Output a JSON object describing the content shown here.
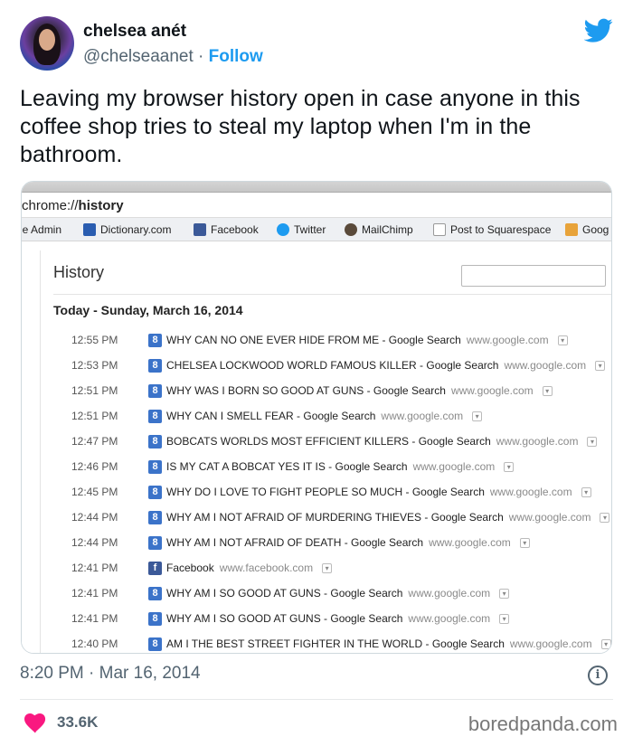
{
  "tweet": {
    "display_name": "chelsea anét",
    "handle": "@chelseaanet",
    "separator": " · ",
    "follow_label": "Follow",
    "text": "Leaving my browser history open in case anyone in this coffee shop tries to steal my laptop when I'm in the bathroom.",
    "timestamp": "8:20 PM · Mar 16, 2014",
    "likes": "33.6K",
    "accent_color": "#1d9bf0",
    "like_color": "#f91880"
  },
  "browser": {
    "url_prefix": "chrome://",
    "url_path": "history",
    "bookmarks": [
      {
        "label": "le Admin",
        "icon": "admin-icon",
        "color": "#999999"
      },
      {
        "label": "Dictionary.com",
        "icon": "dictionary-icon",
        "color": "#2a5db0"
      },
      {
        "label": "Facebook",
        "icon": "facebook-icon",
        "color": "#3b5998"
      },
      {
        "label": "Twitter",
        "icon": "twitter-icon",
        "color": "#1d9bf0"
      },
      {
        "label": "MailChimp",
        "icon": "mailchimp-icon",
        "color": "#5a4a3a"
      },
      {
        "label": "Post to Squarespace",
        "icon": "page-icon",
        "color": "#ffffff"
      },
      {
        "label": "Goog",
        "icon": "google-icon",
        "color": "#e8a33a"
      }
    ]
  },
  "history": {
    "title": "History",
    "day_heading": "Today - Sunday, March 16, 2014",
    "entries": [
      {
        "time": "12:55 PM",
        "title": "WHY CAN NO ONE EVER HIDE FROM ME - Google Search",
        "domain": "www.google.com",
        "favicon": "google-icon"
      },
      {
        "time": "12:53 PM",
        "title": "CHELSEA LOCKWOOD WORLD FAMOUS KILLER - Google Search",
        "domain": "www.google.com",
        "favicon": "google-icon"
      },
      {
        "time": "12:51 PM",
        "title": "WHY WAS I BORN SO GOOD AT GUNS - Google Search",
        "domain": "www.google.com",
        "favicon": "google-icon"
      },
      {
        "time": "12:51 PM",
        "title": "WHY CAN I SMELL FEAR - Google Search",
        "domain": "www.google.com",
        "favicon": "google-icon"
      },
      {
        "time": "12:47 PM",
        "title": "BOBCATS WORLDS MOST EFFICIENT KILLERS - Google Search",
        "domain": "www.google.com",
        "favicon": "google-icon"
      },
      {
        "time": "12:46 PM",
        "title": "IS MY CAT A BOBCAT YES IT IS - Google Search",
        "domain": "www.google.com",
        "favicon": "google-icon"
      },
      {
        "time": "12:45 PM",
        "title": "WHY DO I LOVE TO FIGHT PEOPLE SO MUCH - Google Search",
        "domain": "www.google.com",
        "favicon": "google-icon"
      },
      {
        "time": "12:44 PM",
        "title": "WHY AM I NOT AFRAID OF MURDERING THIEVES - Google Search",
        "domain": "www.google.com",
        "favicon": "google-icon"
      },
      {
        "time": "12:44 PM",
        "title": "WHY AM I NOT AFRAID OF DEATH - Google Search",
        "domain": "www.google.com",
        "favicon": "google-icon"
      },
      {
        "time": "12:41 PM",
        "title": "Facebook",
        "domain": "www.facebook.com",
        "favicon": "facebook-icon"
      },
      {
        "time": "12:41 PM",
        "title": "WHY AM I SO GOOD AT GUNS - Google Search",
        "domain": "www.google.com",
        "favicon": "google-icon"
      },
      {
        "time": "12:41 PM",
        "title": "WHY AM I SO GOOD AT GUNS - Google Search",
        "domain": "www.google.com",
        "favicon": "google-icon"
      },
      {
        "time": "12:40 PM",
        "title": "AM I THE BEST STREET FIGHTER IN THE WORLD - Google Search",
        "domain": "www.google.com",
        "favicon": "google-icon"
      }
    ]
  },
  "watermark": "boredpanda.com"
}
